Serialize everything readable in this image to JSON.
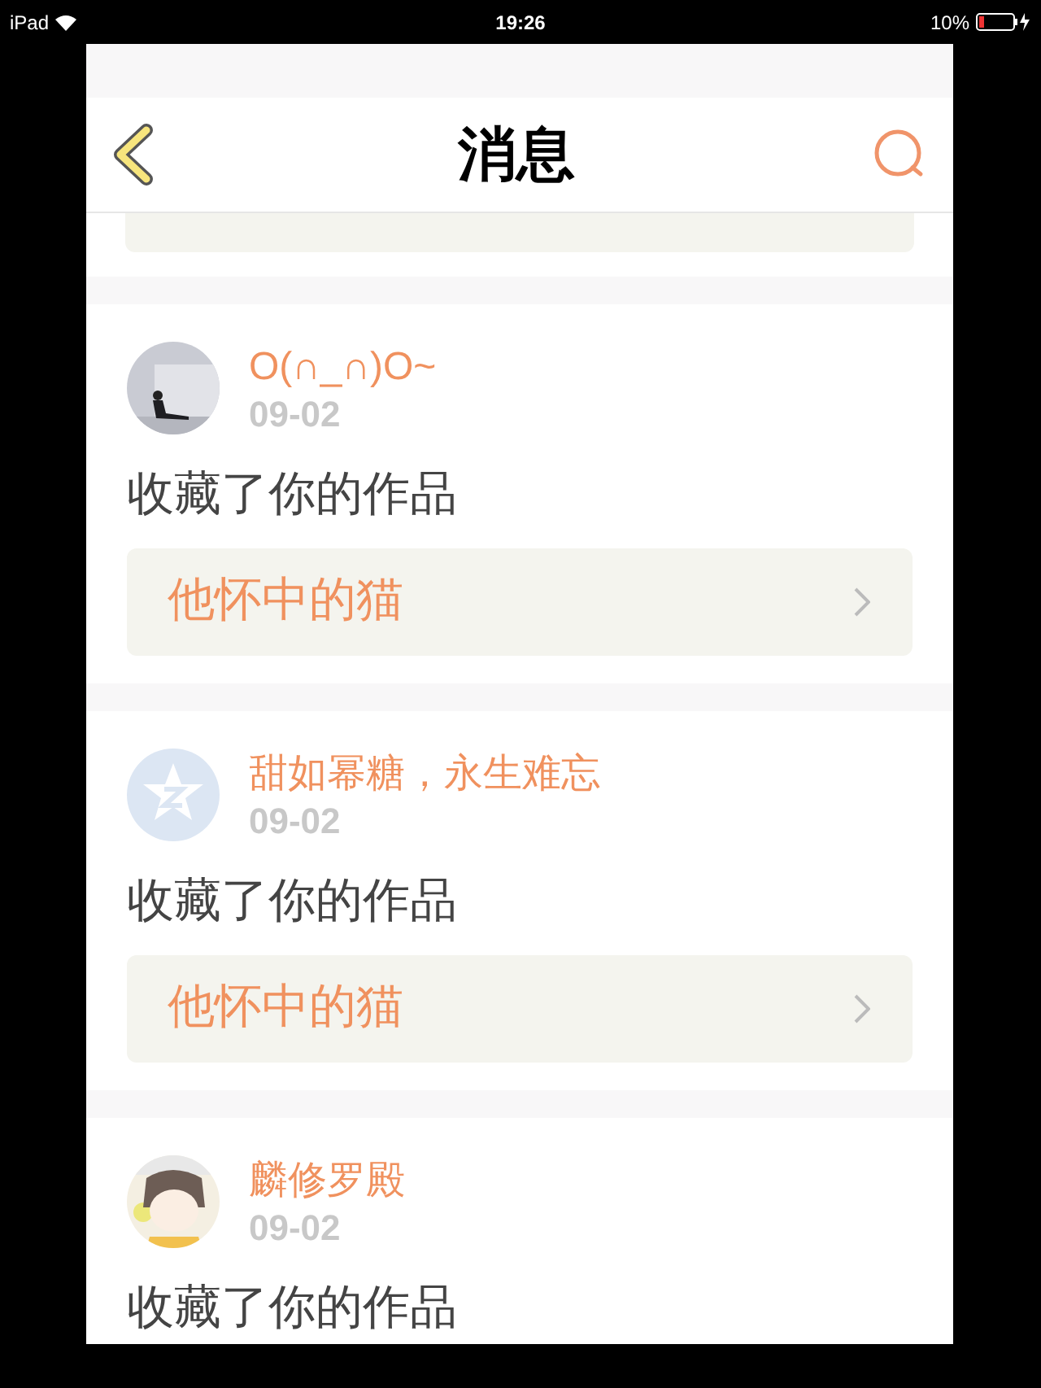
{
  "status_bar": {
    "device": "iPad",
    "time": "19:26",
    "battery": "10%"
  },
  "header": {
    "title": "消息"
  },
  "messages": [
    {
      "name": "O(∩_∩)O~",
      "date": "09-02",
      "text": "收藏了你的作品",
      "work": "他怀中的猫"
    },
    {
      "name": "甜如幂糖，永生难忘",
      "avatar": {
        "kind": "default"
      },
      "date": "09-02",
      "text": "收藏了你的作品",
      "work": "他怀中的猫"
    },
    {
      "name": "麟修罗殿",
      "date": "09-02",
      "text": "收藏了你的作品"
    }
  ]
}
